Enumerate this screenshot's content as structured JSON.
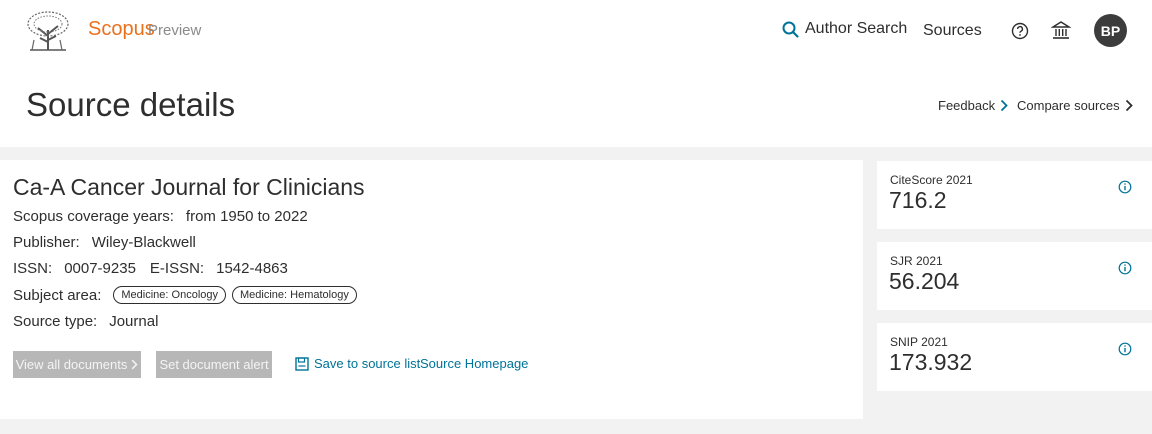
{
  "header": {
    "brand": "Scopus",
    "brand_sub": "Preview",
    "nav": {
      "author_search": "Author Search",
      "sources": "Sources"
    },
    "avatar_initials": "BP",
    "icons": [
      "elsevier-tree-logo",
      "search-icon",
      "help-icon",
      "institution-icon"
    ]
  },
  "title_row": {
    "page_title": "Source details",
    "feedback": "Feedback",
    "compare": "Compare sources"
  },
  "source": {
    "title": "Ca-A Cancer Journal for Clinicians",
    "coverage_label": "Scopus coverage years:",
    "coverage_value": "from 1950 to 2022",
    "publisher_label": "Publisher:",
    "publisher_value": "Wiley-Blackwell",
    "issn_label": "ISSN:",
    "issn_value": "0007-9235",
    "eissn_label": "E-ISSN:",
    "eissn_value": "1542-4863",
    "subject_label": "Subject area:",
    "subjects": [
      "Medicine: Oncology",
      "Medicine: Hematology"
    ],
    "type_label": "Source type:",
    "type_value": "Journal"
  },
  "actions": {
    "view_all": "View all documents",
    "set_alert": "Set document alert",
    "save_list": "Save to source list",
    "homepage": "Source Homepage"
  },
  "metrics": [
    {
      "label": "CiteScore 2021",
      "value": "716.2"
    },
    {
      "label": "SJR 2021",
      "value": "56.204"
    },
    {
      "label": "SNIP 2021",
      "value": "173.932"
    }
  ],
  "colors": {
    "brand_orange": "#e9711c",
    "link_blue": "#007398",
    "disabled_button": "#b7b7b7",
    "band_grey": "#f2f2f2"
  }
}
